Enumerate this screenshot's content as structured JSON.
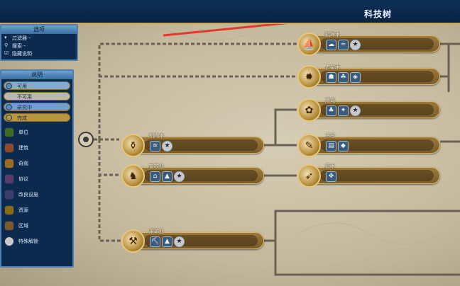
{
  "header": {
    "title": "科技树"
  },
  "options_panel": {
    "title": "选项",
    "items": [
      {
        "label": "过滤器···",
        "icon": "funnel-icon"
      },
      {
        "label": "搜索···",
        "icon": "magnifier-icon"
      },
      {
        "label": "隐藏说明",
        "icon": "checkbox-icon"
      }
    ]
  },
  "legend_panel": {
    "title": "说明",
    "toggles": [
      "可用",
      "不可用",
      "研究中",
      "完成"
    ],
    "categories": [
      {
        "label": "单位",
        "color": "#3f6b1f"
      },
      {
        "label": "建筑",
        "color": "#8c4a2b"
      },
      {
        "label": "奇观",
        "color": "#9b6b1f"
      },
      {
        "label": "协议",
        "color": "#5a3a6a"
      },
      {
        "label": "改良设施",
        "color": "#3d3d6b"
      },
      {
        "label": "资源",
        "color": "#8b6a16"
      },
      {
        "label": "区域",
        "color": "#7a5a2a"
      },
      {
        "label": "特殊解锁",
        "color": "#c9c9c9"
      }
    ]
  },
  "techs": [
    {
      "id": "pottery",
      "name": "制陶术",
      "icon": "⚱",
      "unlocks": [
        "≋",
        "★"
      ]
    },
    {
      "id": "animal",
      "name": "畜牧业",
      "icon": "♞",
      "unlocks": [
        "⌂",
        "▲",
        "★"
      ]
    },
    {
      "id": "mining",
      "name": "采矿业",
      "icon": "⚒",
      "unlocks": [
        "⛏",
        "▲",
        "★"
      ]
    },
    {
      "id": "sailing",
      "name": "航海术",
      "icon": "⛵",
      "unlocks": [
        "☁",
        "≈",
        "★"
      ]
    },
    {
      "id": "astrology",
      "name": "占星术",
      "icon": "✹",
      "unlocks": [
        "☗",
        "☘",
        "◈"
      ]
    },
    {
      "id": "irrigation",
      "name": "灌溉",
      "icon": "✿",
      "unlocks": [
        "♣",
        "✦",
        "★"
      ]
    },
    {
      "id": "writing",
      "name": "书写",
      "icon": "✎",
      "unlocks": [
        "▤",
        "◆"
      ]
    },
    {
      "id": "archery",
      "name": "箭术",
      "icon": "➶",
      "unlocks": [
        "✥"
      ]
    }
  ]
}
